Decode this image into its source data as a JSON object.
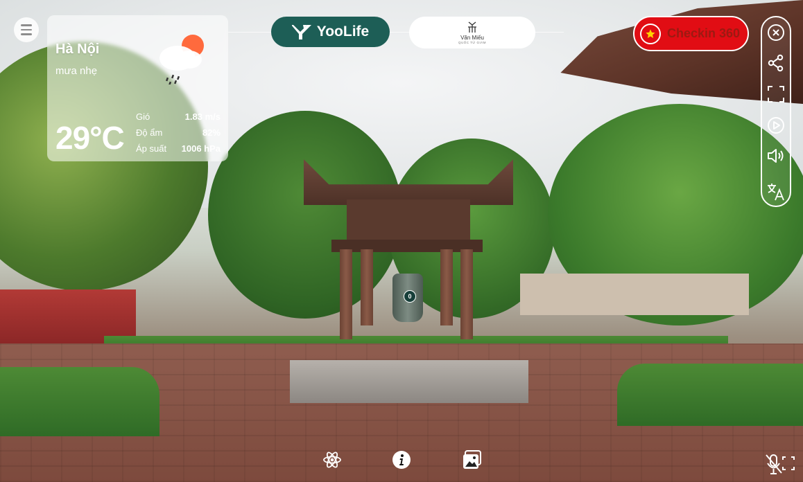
{
  "weather": {
    "city": "Hà Nội",
    "description": "mưa nhẹ",
    "temperature": "29°C",
    "stats": [
      {
        "label": "Gió",
        "value": "1.83 m/s"
      },
      {
        "label": "Độ ẩm",
        "value": "82%"
      },
      {
        "label": "Áp suất",
        "value": "1006 hPa"
      }
    ],
    "icon": "rain-cloud-sun-icon"
  },
  "brand": {
    "name": "YooLife",
    "icon": "yoolife-logo-icon",
    "color": "#1d5e56"
  },
  "partner": {
    "line1": "Văn Miếu",
    "line2": "QUỐC TỬ GIÁM",
    "icon": "van-mieu-logo-icon"
  },
  "checkin": {
    "label": "Checkin 360",
    "icon": "vietnam-flag-star-icon",
    "color": "#e10d14"
  },
  "toolbar": [
    {
      "name": "close-icon"
    },
    {
      "name": "share-icon"
    },
    {
      "name": "fullscreen-icon"
    },
    {
      "name": "play-icon"
    },
    {
      "name": "volume-icon"
    },
    {
      "name": "translate-icon"
    }
  ],
  "bottom_bar": [
    {
      "name": "atom-icon"
    },
    {
      "name": "info-icon"
    },
    {
      "name": "gallery-icon"
    }
  ],
  "hotspot": {
    "label": "0"
  },
  "voice": {
    "icon": "voice-control-icon"
  }
}
